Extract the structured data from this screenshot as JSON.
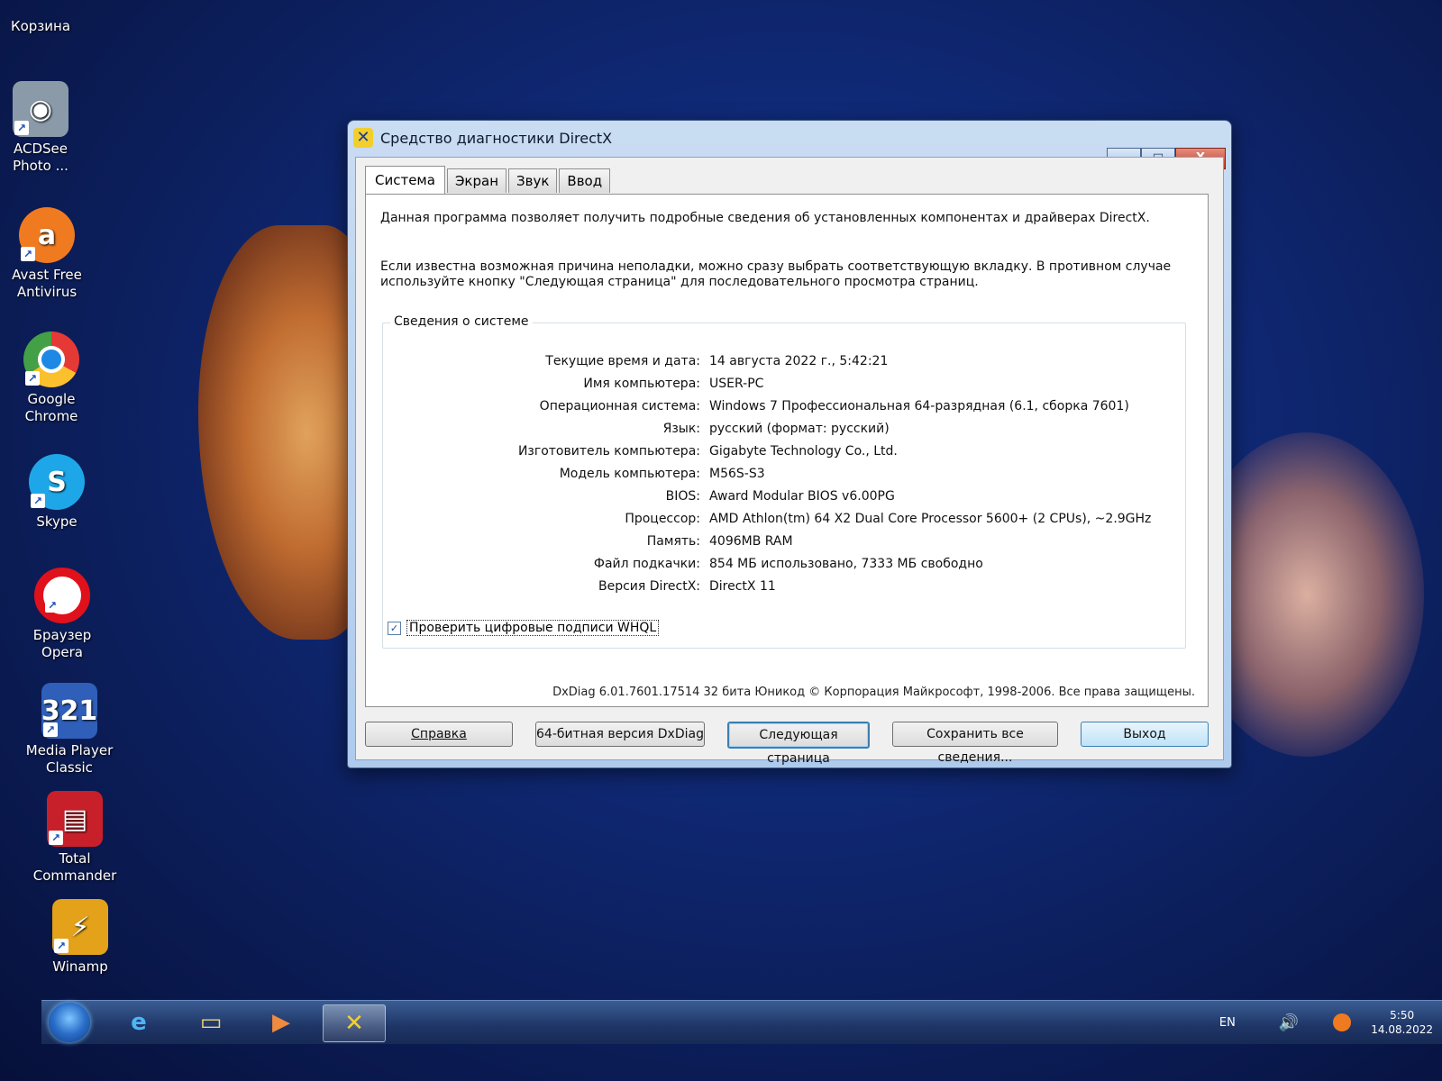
{
  "desktop": {
    "icons": [
      {
        "label": "Корзина",
        "icon": "recycle-bin-icon"
      },
      {
        "label": "ACDSee\nPhoto ...",
        "icon": "acdsee-icon",
        "color": "#8a9aa8"
      },
      {
        "label": "Avast Free\nAntivirus",
        "icon": "avast-icon",
        "color": "#f07a1f"
      },
      {
        "label": "Google\nChrome",
        "icon": "chrome-icon",
        "color": "#e53935"
      },
      {
        "label": "Skype",
        "icon": "skype-icon",
        "color": "#1ea7e8"
      },
      {
        "label": "Браузер\nOpera",
        "icon": "opera-icon",
        "color": "#e0111b"
      },
      {
        "label": "Media Player\nClassic",
        "icon": "media-player-classic-icon",
        "color": "#2f5fb8"
      },
      {
        "label": "Total\nCommander",
        "icon": "total-commander-icon",
        "color": "#c8202a"
      },
      {
        "label": "Winamp",
        "icon": "winamp-icon",
        "color": "#e3a21a"
      }
    ]
  },
  "window": {
    "title": "Средство диагностики DirectX",
    "controls": {
      "minimize": "—",
      "maximize": "□",
      "close": "X"
    },
    "tabs": [
      "Система",
      "Экран",
      "Звук",
      "Ввод"
    ],
    "intro1": "Данная программа позволяет получить подробные сведения об установленных компонентах и драйверах DirectX.",
    "intro2": "Если известна возможная причина неполадки, можно сразу выбрать соответствующую вкладку. В противном случае используйте кнопку \"Следующая страница\" для последовательного просмотра страниц.",
    "group_title": "Сведения о системе",
    "info": [
      {
        "label": "Текущие время и дата:",
        "value": "14 августа 2022 г., 5:42:21"
      },
      {
        "label": "Имя компьютера:",
        "value": "USER-PC"
      },
      {
        "label": "Операционная система:",
        "value": "Windows 7 Профессиональная 64-разрядная (6.1, сборка 7601)"
      },
      {
        "label": "Язык:",
        "value": "русский (формат: русский)"
      },
      {
        "label": "Изготовитель компьютера:",
        "value": "Gigabyte Technology Co., Ltd."
      },
      {
        "label": "Модель компьютера:",
        "value": "M56S-S3"
      },
      {
        "label": "BIOS:",
        "value": "Award Modular BIOS v6.00PG"
      },
      {
        "label": "Процессор:",
        "value": "AMD Athlon(tm) 64 X2 Dual Core Processor 5600+ (2 CPUs), ~2.9GHz"
      },
      {
        "label": "Память:",
        "value": "4096MB RAM"
      },
      {
        "label": "Файл подкачки:",
        "value": "854 МБ использовано, 7333 МБ свободно"
      },
      {
        "label": "Версия DirectX:",
        "value": "DirectX 11"
      }
    ],
    "whql_label": "Проверить цифровые подписи WHQL",
    "whql_checked": true,
    "copyright": "DxDiag 6.01.7601.17514 32 бита Юникод  © Корпорация Майкрософт, 1998-2006.  Все права защищены.",
    "buttons": {
      "help": "Справка",
      "dxdiag64": "64-битная версия DxDiag",
      "next": "Следующая страница",
      "save": "Сохранить все сведения...",
      "exit": "Выход"
    }
  },
  "taskbar": {
    "lang": "EN",
    "time": "5:50",
    "date": "14.08.2022"
  }
}
